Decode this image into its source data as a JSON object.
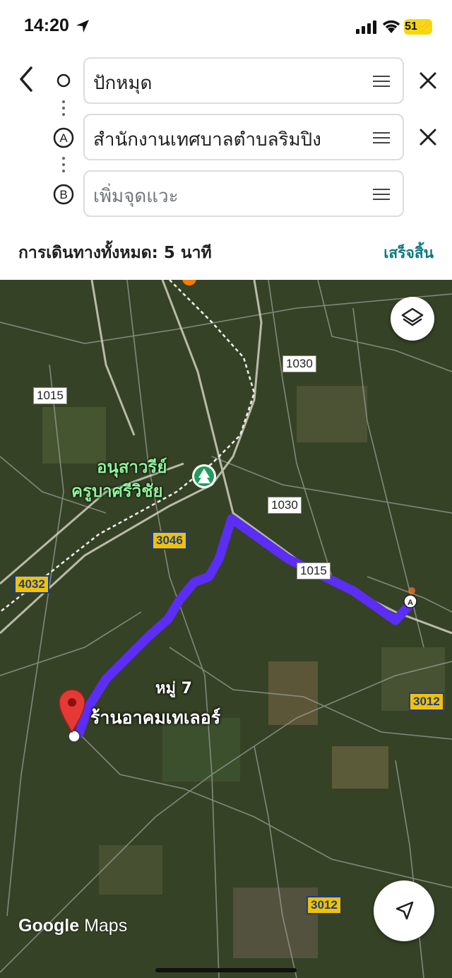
{
  "status_bar": {
    "time": "14:20",
    "battery": "51"
  },
  "route": {
    "origin": {
      "value": "ปักหมุด"
    },
    "stop_a": {
      "marker": "A",
      "value": "สำนักงานเทศบาลตำบลริมปิง"
    },
    "stop_b": {
      "marker": "B",
      "placeholder": "เพิ่มจุดแวะ"
    }
  },
  "summary": {
    "total_travel": "การเดินทางทั้งหมด: 5 นาที",
    "done_label": "เสร็จสิ้น"
  },
  "map": {
    "road_labels": [
      "1030",
      "1015",
      "1030",
      "3046",
      "1015",
      "4032",
      "3012",
      "3012"
    ],
    "poi_line1": "อนุสาวรีย์",
    "poi_line2": "ครูบาศรีวิชัย",
    "village": "หมู่ 7",
    "destination_place": "ร้านอาคมเทเลอร์",
    "route_color": "#5b2df5",
    "pin_color": "#e53935",
    "logo_google": "Google",
    "logo_maps": "Maps"
  },
  "icons": {
    "back": "chevron-left-icon",
    "close": "close-icon",
    "drag": "drag-handle-icon",
    "layers": "layers-icon",
    "locate": "navigation-arrow-icon",
    "poi": "park-tree-icon"
  }
}
